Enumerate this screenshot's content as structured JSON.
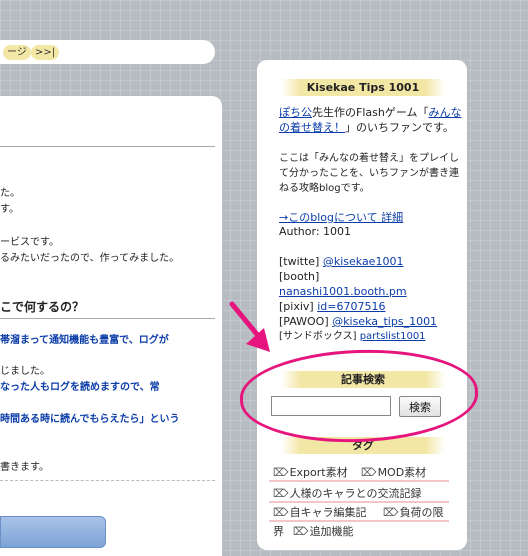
{
  "pager": {
    "prev_label": "ージ",
    "last_label": ">>|"
  },
  "article": {
    "lines": [
      "た。",
      "す。",
      "ービスです。",
      "るみたいだったので、作ってみました。"
    ],
    "heading": "こで何するの？",
    "blue1": "帯溜まって通知機能も豊富で、ログが",
    "line5": "じました。",
    "blue2": "なった人もログを読めますので、常",
    "blue3": "時間ある時に読んでもらえたら」という",
    "line6": "書きます。"
  },
  "sidebar": {
    "title": "Kisekae Tips 1001",
    "intro_author_link": "ぽち公",
    "intro_mid": "先生作のFlashゲーム「",
    "intro_game_link_1": "みんな",
    "intro_game_link_2": "の着せ替え！",
    "intro_end": "」のいちファンです。",
    "desc_1": "ここは「みんなの着せ替え」をプレイし",
    "desc_2": "て分かったことを、いちファンが書き連",
    "desc_3": "ねる攻略blogです。",
    "about_link": "→このblogについて 詳細",
    "author": "Author: 1001",
    "twitter_label": "[twitte] ",
    "twitter_handle": "@kisekae1001",
    "booth_label": "[booth]",
    "booth_link": "nanashi1001.booth.pm",
    "pixiv_label": "[pixiv] ",
    "pixiv_link": "id=6707516",
    "pawoo_label": "[PAWOO] ",
    "pawoo_link": "@kiseka_tips_1001",
    "sandbox_label": "[サンドボックス] ",
    "sandbox_link": "partslist1001"
  },
  "search": {
    "title": "記事検索",
    "button": "検索",
    "value": ""
  },
  "tags": {
    "title": "タグ",
    "items": [
      "Export素材",
      "MOD素材",
      "人様のキャラとの交流記録",
      "自キャラ編集記",
      "負荷の限",
      "界",
      "追加機能"
    ]
  },
  "colors": {
    "highlight": "#e6147d",
    "link": "#0b3da8",
    "header_band": "#f3e7a6"
  }
}
